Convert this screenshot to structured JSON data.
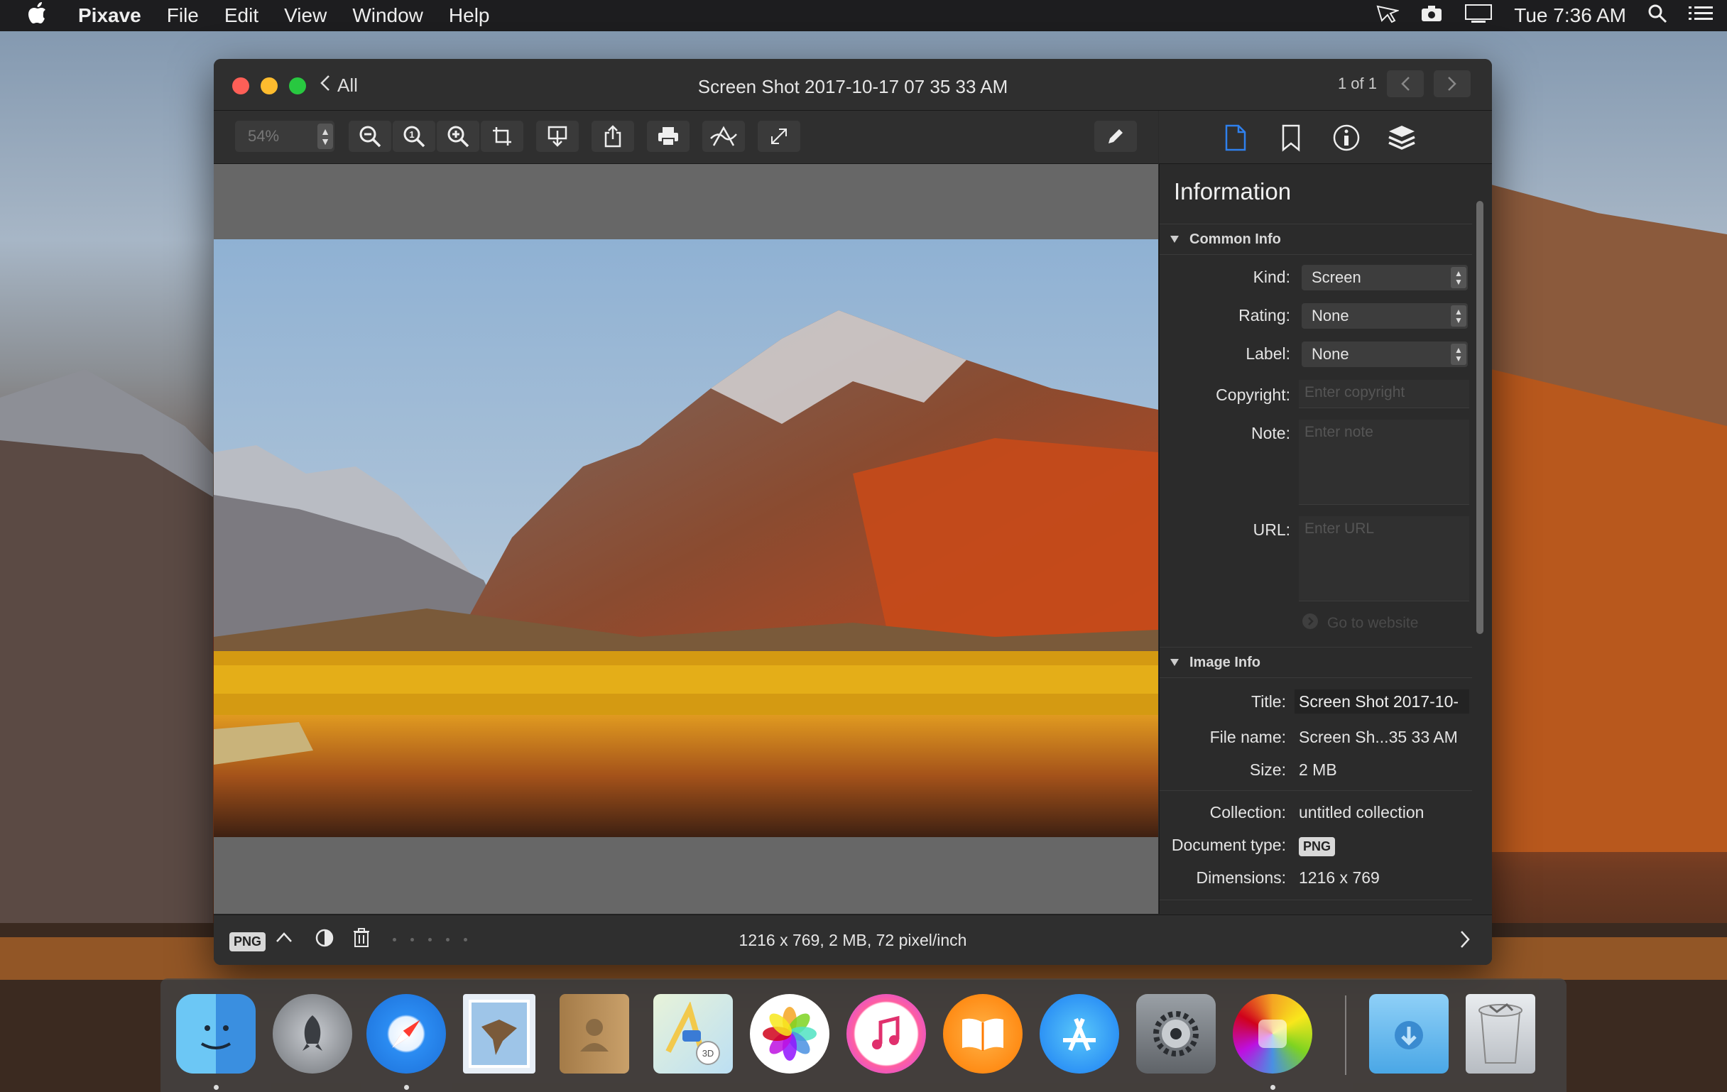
{
  "menubar": {
    "apple": "",
    "app_name": "Pixave",
    "menus": [
      "File",
      "Edit",
      "View",
      "Window",
      "Help"
    ],
    "clock": "Tue 7:36 AM"
  },
  "window": {
    "back_label": "All",
    "title": "Screen Shot 2017-10-17 07 35 33 AM",
    "pager": "1 of 1",
    "zoom_value": "54%"
  },
  "inspector": {
    "title": "Information",
    "common_info_header": "Common Info",
    "kind_label": "Kind:",
    "kind_value": "Screen",
    "rating_label": "Rating:",
    "rating_value": "None",
    "label_label": "Label:",
    "label_value": "None",
    "copyright_label": "Copyright:",
    "copyright_placeholder": "Enter copyright",
    "note_label": "Note:",
    "note_placeholder": "Enter note",
    "url_label": "URL:",
    "url_placeholder": "Enter URL",
    "go_to_website": "Go to website",
    "image_info_header": "Image Info",
    "title_label": "Title:",
    "title_value": "Screen Shot 2017-10-",
    "filename_label": "File name:",
    "filename_value": "Screen Sh...35 33 AM",
    "size_label": "Size:",
    "size_value": "2 MB",
    "collection_label": "Collection:",
    "collection_value": "untitled collection",
    "doctype_label": "Document type:",
    "doctype_value": "PNG",
    "dimensions_label": "Dimensions:",
    "dimensions_value": "1216 x 769"
  },
  "statusbar": {
    "badge": "PNG",
    "info": "1216 x 769, 2 MB, 72 pixel/inch"
  },
  "colors": {
    "close": "#fe5f57",
    "minimize": "#febc2e",
    "zoom": "#28c840",
    "accent": "#2f80ed"
  },
  "icons": {
    "menubar_right": [
      "airdrop-like-icon",
      "camera-icon",
      "display-icon",
      "spotlight-icon",
      "list-icon"
    ],
    "toolbar": [
      "zoom-out-icon",
      "actual-size-icon",
      "zoom-in-icon",
      "crop-icon",
      "download-icon",
      "share-icon",
      "print-icon",
      "markup-icon",
      "fullscreen-icon",
      "pencil-icon"
    ],
    "sidebar_tabs": [
      "document-icon",
      "bookmark-icon",
      "info-icon",
      "layers-icon"
    ],
    "dock": [
      "finder",
      "launchpad",
      "safari",
      "mail",
      "contacts",
      "maps",
      "photos",
      "itunes",
      "ibooks",
      "app-store",
      "system-preferences",
      "pixave",
      "downloads",
      "trash"
    ]
  }
}
